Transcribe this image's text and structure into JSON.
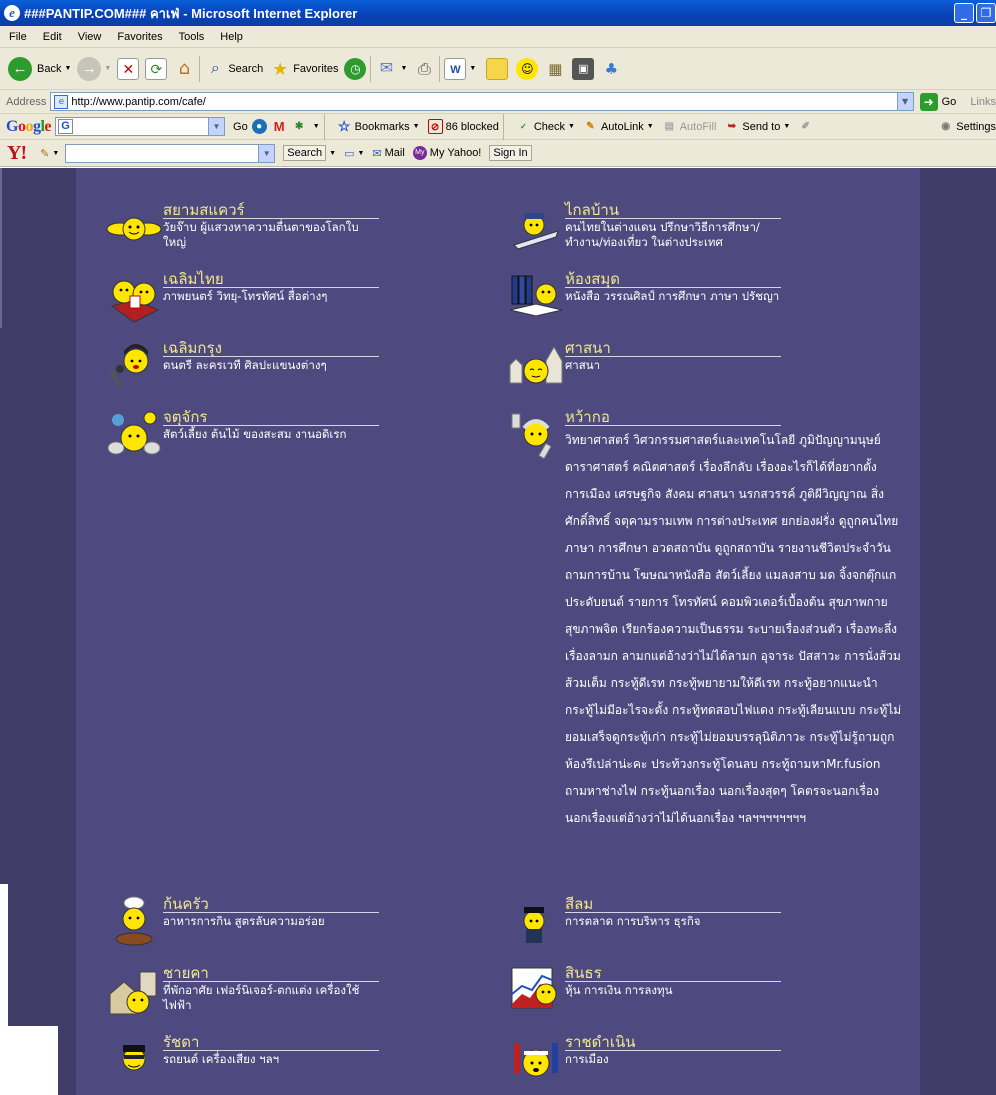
{
  "window": {
    "title": "###PANTIP.COM### คาเฟ่ - Microsoft Internet Explorer"
  },
  "menu": {
    "items": [
      "File",
      "Edit",
      "View",
      "Favorites",
      "Tools",
      "Help"
    ]
  },
  "toolbar": {
    "back": "Back",
    "search": "Search",
    "favorites": "Favorites"
  },
  "address": {
    "label": "Address",
    "url": "http://www.pantip.com/cafe/",
    "go": "Go",
    "links": "Links"
  },
  "google": {
    "go": "Go",
    "bookmarks": "Bookmarks",
    "blocked": "86 blocked",
    "check": "Check",
    "autolink": "AutoLink",
    "autofill": "AutoFill",
    "sendto": "Send to",
    "settings": "Settings"
  },
  "yahoo": {
    "search": "Search",
    "mail": "Mail",
    "myyahoo": "My Yahoo!",
    "signin": "Sign In"
  },
  "forums": {
    "f1": {
      "name": "สยามสแควร์",
      "desc": "วัยจ๊าบ ผู้แสวงหาความตื่นตาของโลกใบใหญ่"
    },
    "f2": {
      "name": "ไกลบ้าน",
      "desc": "คนไทยในต่างแดน ปรึกษาวิธีการศึกษา/ทำงาน/ท่องเที่ยว ในต่างประเทศ"
    },
    "f3": {
      "name": "เฉลิมไทย",
      "desc": "ภาพยนตร์ วิทยุ-โทรทัศน์ สื่อต่างๆ"
    },
    "f4": {
      "name": "ห้องสมุด",
      "desc": "หนังสือ วรรณศิลป์ การศึกษา ภาษา ปรัชญา"
    },
    "f5": {
      "name": "เฉลิมกรุง",
      "desc": "ดนตรี ละครเวที ศิลปะแขนงต่างๆ"
    },
    "f6": {
      "name": "ศาสนา",
      "desc": "ศาสนา"
    },
    "f7": {
      "name": "จตุจักร",
      "desc": "สัตว์เลี้ยง ต้นไม้ ของสะสม งานอดิเรก"
    },
    "f8": {
      "name": "หว้ากอ",
      "desc": "วิทยาศาสตร์ วิศวกรรมศาสตร์และเทคโนโลยี ภูมิปัญญามนุษย์ ดาราศาสตร์ คณิตศาสตร์ เรื่องลึกลับ เรื่องอะไรก็ได้ที่อยากตั้ง การเมือง เศรษฐกิจ สังคม ศาสนา นรกสวรรค์ ภูติผีวิญญาณ สิ่งศักดิ์สิทธิ์ จตุคามรามเทพ การต่างประเทศ ยกย่องฝรั่ง ดูถูกคนไทย ภาษา การศึกษา อวดสถาบัน ดูถูกสถาบัน รายงานชีวิตประจำวัน ถามการบ้าน โฆษณาหนังสือ สัตว์เลี้ยง แมลงสาบ มด จิ้งจกตุ๊กแก ประดับยนต์ รายการ โทรทัศน์ คอมพิวเตอร์เบื้องต้น สุขภาพกาย สุขภาพจิต เรียกร้องความเป็นธรรม ระบายเรื่องส่วนตัว เรื่องทะลึ่ง เรื่องลามก ลามกแต่อ้างว่าไม่ได้ลามก อุจาระ ปัสสาวะ การนั่งส้วม ส้วมเต็ม กระทู้ดีเรท กระทู้พยายามให้ดีเรท กระทู้อยากแนะนำ กระทู้ไม่มีอะไรจะตั้ง กระทู้ทดสอบไฟแดง กระทู้เลียนแบบ กระทู้ไม่ยอมเสร็จดูกระทู้เก่า กระทู้ไม่ยอมบรรลุนิติภาวะ กระทู้ไม่รู้ถามถูกห้องรึเปล่าน่ะคะ ประท้วงกระทู้โดนลบ กระทู้ถามหาMr.fusion ถามหาช่างไฟ กระทู้นอกเรื่อง นอกเรื่องสุดๆ โคตรจะนอกเรื่อง นอกเรื่องแต่อ้างว่าไม่ได้นอกเรื่อง ฯลฯฯฯฯฯฯฯฯ"
    },
    "f9": {
      "name": "ก้นครัว",
      "desc": "อาหารการกิน สูตรลับความอร่อย"
    },
    "f10": {
      "name": "สีลม",
      "desc": "การตลาด การบริหาร ธุรกิจ"
    },
    "f11": {
      "name": "ชายคา",
      "desc": "ที่พักอาศัย เฟอร์นิเจอร์-ตกแต่ง เครื่องใช้ไฟฟ้า"
    },
    "f12": {
      "name": "สินธร",
      "desc": "หุ้น การเงิน การลงทุน"
    },
    "f13": {
      "name": "รัชดา",
      "desc": "รถยนต์ เครื่องเสียง ฯลฯ"
    },
    "f14": {
      "name": "ราชดำเนิน",
      "desc": "การเมือง"
    }
  },
  "colors": {
    "page_bg": "#3f3c68",
    "panel_bg": "#4e4a7f",
    "forum_name": "#f3e78f",
    "smiley": "#ffe600"
  }
}
